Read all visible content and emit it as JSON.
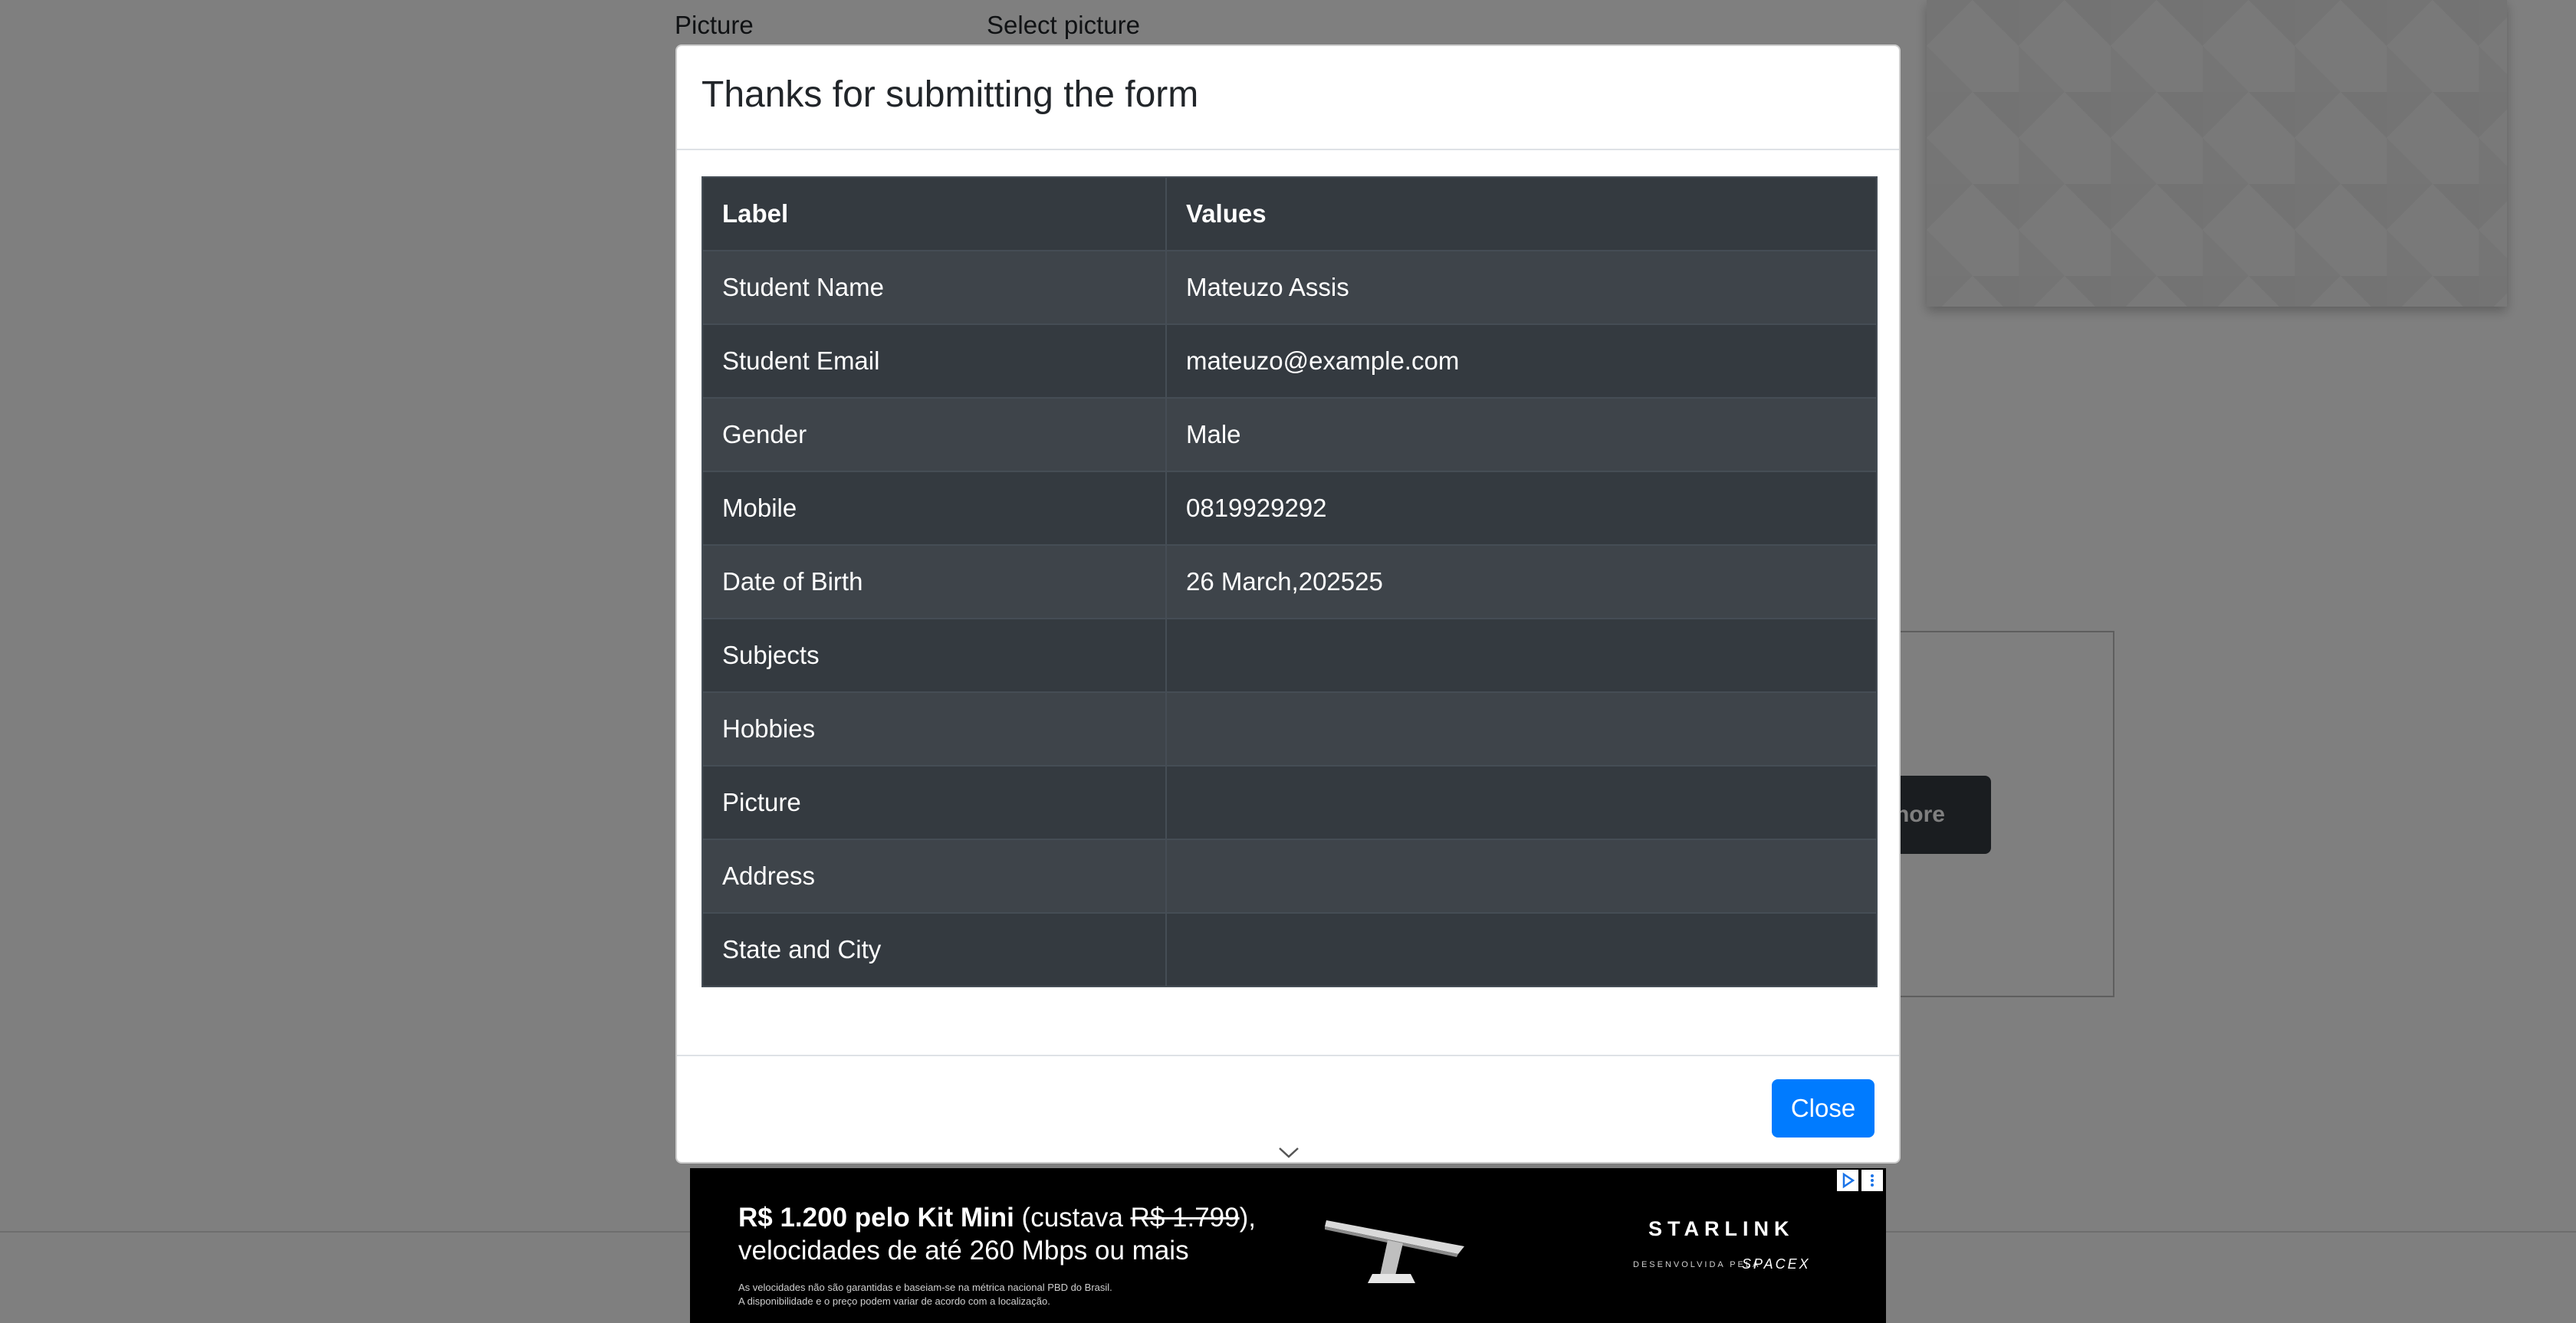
{
  "background": {
    "picture_label": "Picture",
    "select_picture_label": "Select picture",
    "more_button_label": "nore"
  },
  "modal": {
    "title": "Thanks for submitting the form",
    "table": {
      "headers": [
        "Label",
        "Values"
      ],
      "rows": [
        {
          "label": "Student Name",
          "value": "Mateuzo Assis"
        },
        {
          "label": "Student Email",
          "value": "mateuzo@example.com"
        },
        {
          "label": "Gender",
          "value": "Male"
        },
        {
          "label": "Mobile",
          "value": "0819929292"
        },
        {
          "label": "Date of Birth",
          "value": "26 March,202525"
        },
        {
          "label": "Subjects",
          "value": ""
        },
        {
          "label": "Hobbies",
          "value": ""
        },
        {
          "label": "Picture",
          "value": ""
        },
        {
          "label": "Address",
          "value": ""
        },
        {
          "label": "State and City",
          "value": ""
        }
      ]
    },
    "close_label": "Close"
  },
  "ad": {
    "price_bold": "R$ 1.200 pelo Kit Mini",
    "price_mid": " (custava ",
    "price_old": "R$ 1.799",
    "price_end": "),",
    "line2": "velocidades de até 260 Mbps ou mais",
    "fine1": "As velocidades não são garantidas e baseiam-se na métrica nacional PBD do Brasil.",
    "fine2": "A disponibilidade e o preço podem variar de acordo com a localização.",
    "brand": "STARLINK",
    "brand_sub": "DESENVOLVIDA PELA",
    "brand_spacex": "SPACEX"
  },
  "colors": {
    "primary": "#007bff",
    "table_dark": "#343a40",
    "table_dark_alt": "#3e444a",
    "backdrop": "rgba(0,0,0,0.5)"
  }
}
